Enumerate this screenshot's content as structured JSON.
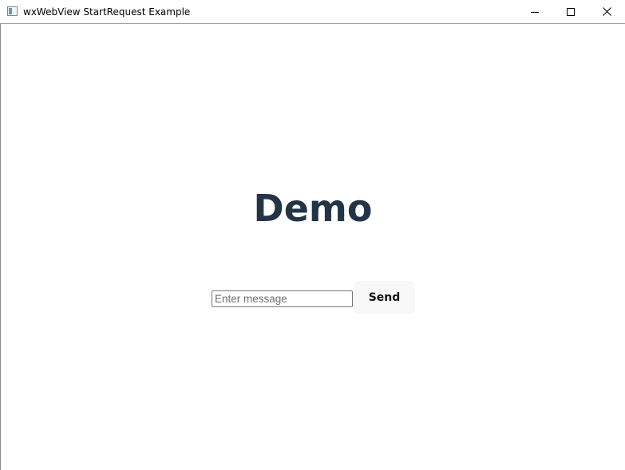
{
  "window": {
    "title": "wxWebView StartRequest Example",
    "controls": {
      "minimize": "minimize-icon",
      "maximize": "maximize-icon",
      "close": "close-icon"
    }
  },
  "page": {
    "heading": "Demo",
    "message_input": {
      "value": "",
      "placeholder": "Enter message"
    },
    "send_label": "Send"
  },
  "colors": {
    "heading": "#243447",
    "button_background": "#f8f8f8"
  }
}
